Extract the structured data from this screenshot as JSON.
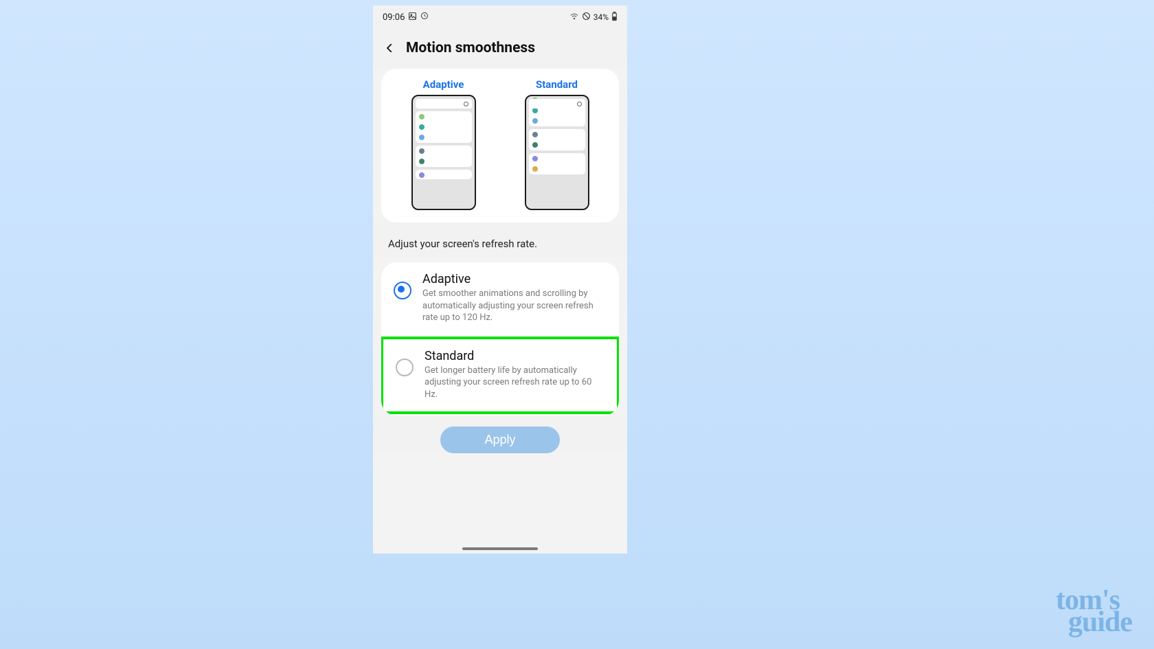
{
  "status_bar": {
    "time": "09:06",
    "battery": "34%"
  },
  "header": {
    "title": "Motion smoothness"
  },
  "preview": {
    "adaptive_label": "Adaptive",
    "standard_label": "Standard"
  },
  "section_text": "Adjust your screen's refresh rate.",
  "options": {
    "adaptive": {
      "title": "Adaptive",
      "description": "Get smoother animations and scrolling by automatically adjusting your screen refresh rate up to 120 Hz.",
      "selected": true
    },
    "standard": {
      "title": "Standard",
      "description": "Get longer battery life by automatically adjusting your screen refresh rate up to 60 Hz.",
      "selected": false,
      "highlighted": true
    }
  },
  "apply_button": "Apply",
  "watermark": {
    "line1": "tom's",
    "line2": "guide"
  }
}
